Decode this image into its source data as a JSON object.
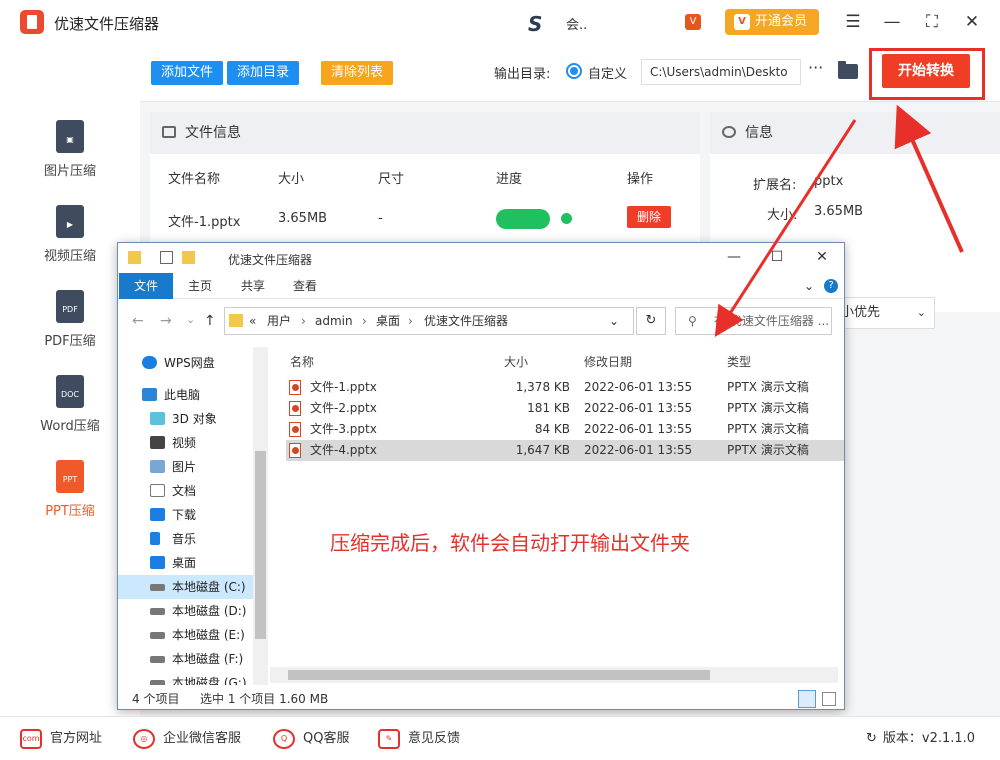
{
  "app": {
    "title": "优速文件压缩器",
    "user_name": "会..",
    "vip_label": "开通会员"
  },
  "sidebar": {
    "items": [
      {
        "label": "图片压缩",
        "icon": "image-file-icon"
      },
      {
        "label": "视频压缩",
        "icon": "video-file-icon"
      },
      {
        "label": "PDF压缩",
        "icon": "pdf-file-icon",
        "tag": "PDF"
      },
      {
        "label": "Word压缩",
        "icon": "word-file-icon",
        "tag": "DOC"
      },
      {
        "label": "PPT压缩",
        "icon": "ppt-file-icon",
        "tag": "PPT",
        "active": true
      }
    ]
  },
  "toolbar": {
    "add_file": "添加文件",
    "add_dir": "添加目录",
    "clear_list": "清除列表",
    "output_label": "输出目录:",
    "output_option": "自定义",
    "output_path": "C:\\Users\\admin\\Deskto",
    "more": "···",
    "start": "开始转换"
  },
  "file_info": {
    "title": "文件信息",
    "headers": [
      "文件名称",
      "大小",
      "尺寸",
      "进度",
      "操作"
    ],
    "row": {
      "name": "文件-1.pptx",
      "size": "3.65MB",
      "dimension": "-",
      "progress": 1.0,
      "action": "删除"
    }
  },
  "info": {
    "title": "信息",
    "ext_label": "扩展名:",
    "ext_value": "pptx",
    "size_label": "大小:",
    "size_value": "3.65MB",
    "priority": "小优先"
  },
  "explorer": {
    "title": "优速文件压缩器",
    "tabs": [
      "文件",
      "主页",
      "共享",
      "查看"
    ],
    "path": [
      "«",
      "用户",
      "admin",
      "桌面",
      "优速文件压缩器"
    ],
    "search_placeholder": "在 优速文件压缩器 ...",
    "tree": [
      "WPS网盘",
      "此电脑",
      "3D 对象",
      "视频",
      "图片",
      "文档",
      "下载",
      "音乐",
      "桌面",
      "本地磁盘 (C:)",
      "本地磁盘 (D:)",
      "本地磁盘 (E:)",
      "本地磁盘 (F:)",
      "本地磁盘 (G:)"
    ],
    "columns": [
      "名称",
      "大小",
      "修改日期",
      "类型"
    ],
    "files": [
      {
        "name": "文件-1.pptx",
        "size": "1,378 KB",
        "date": "2022-06-01 13:55",
        "type": "PPTX 演示文稿"
      },
      {
        "name": "文件-2.pptx",
        "size": "181 KB",
        "date": "2022-06-01 13:55",
        "type": "PPTX 演示文稿"
      },
      {
        "name": "文件-3.pptx",
        "size": "84 KB",
        "date": "2022-06-01 13:55",
        "type": "PPTX 演示文稿"
      },
      {
        "name": "文件-4.pptx",
        "size": "1,647 KB",
        "date": "2022-06-01 13:55",
        "type": "PPTX 演示文稿",
        "selected": true
      }
    ],
    "status_count": "4 个项目",
    "status_selected": "选中 1 个项目  1.60 MB"
  },
  "annotation": "压缩完成后，软件会自动打开输出文件夹",
  "footer": {
    "website": "官方网址",
    "wechat": "企业微信客服",
    "qq": "QQ客服",
    "feedback": "意见反馈",
    "version": "版本：v2.1.1.0"
  },
  "colors": {
    "accent": "#f03e26",
    "blue": "#1e8ff0",
    "orange": "#f7a51b",
    "progress": "#20c060"
  }
}
